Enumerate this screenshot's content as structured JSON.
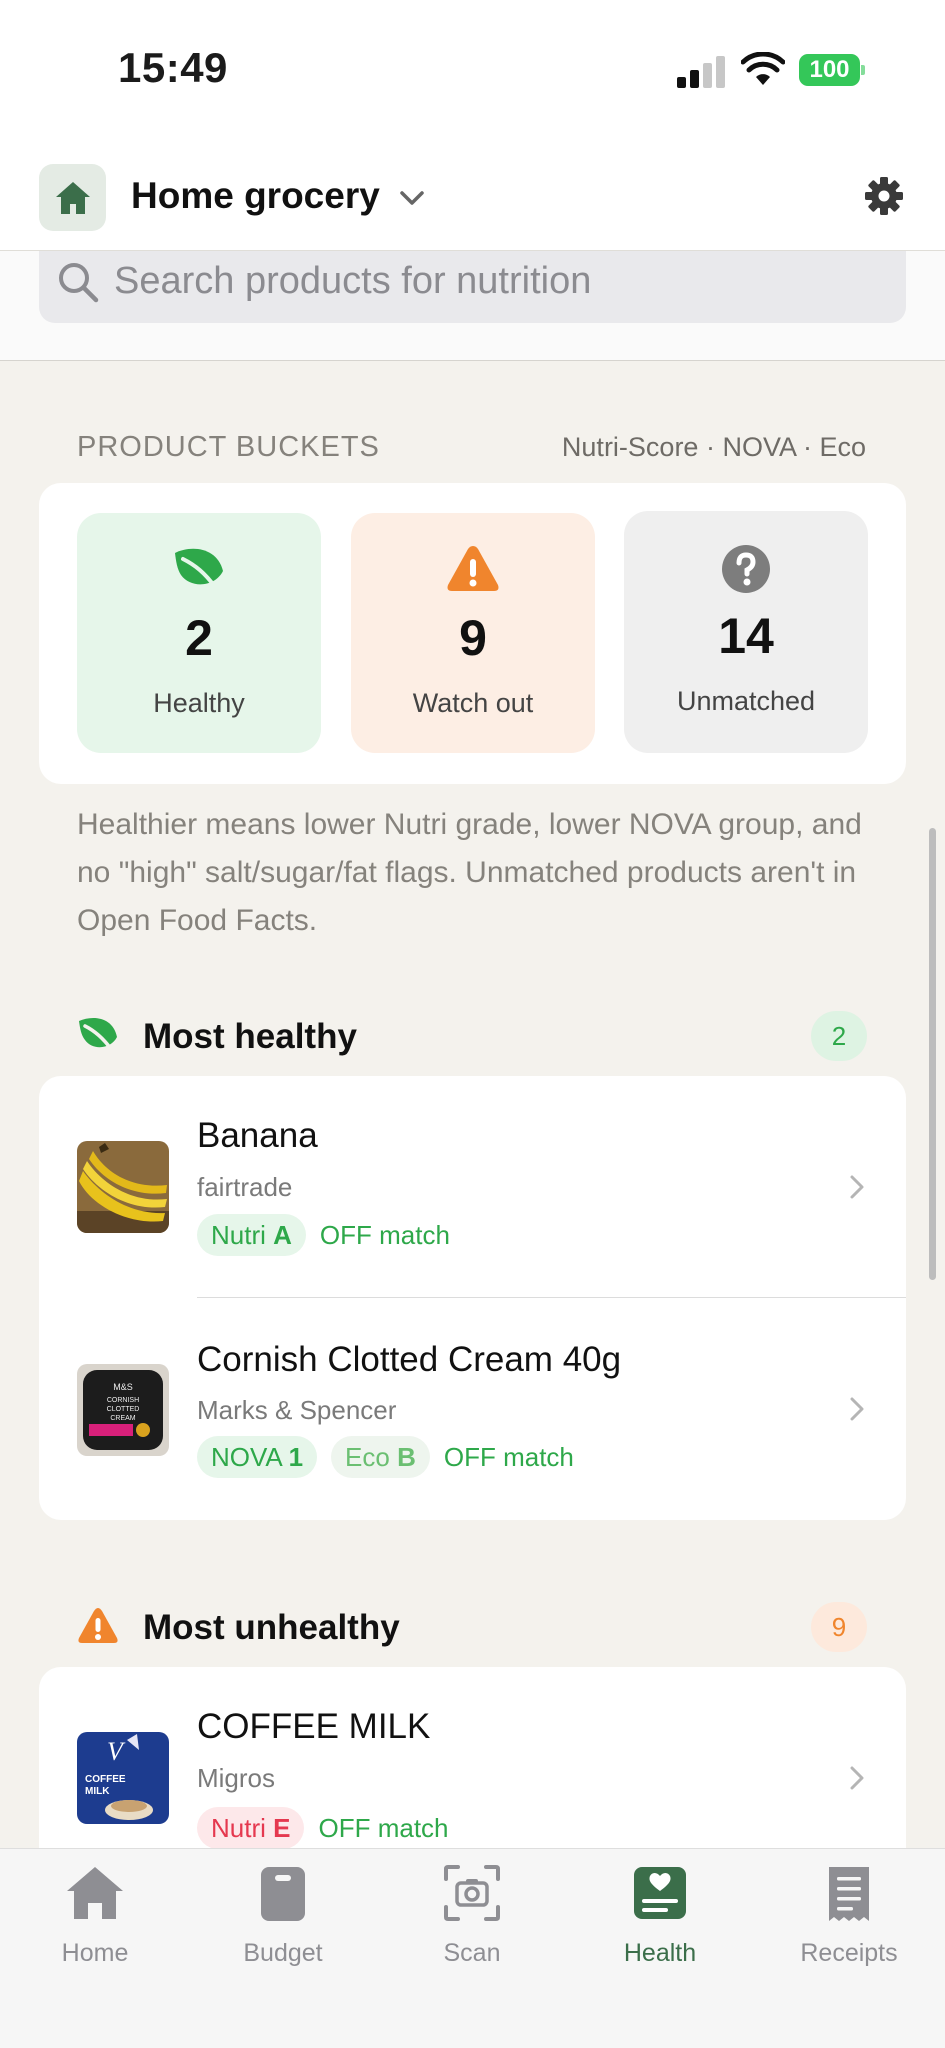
{
  "status_bar": {
    "time": "15:49",
    "battery": "100"
  },
  "header": {
    "title": "Home grocery"
  },
  "search": {
    "placeholder": "Search products for nutrition"
  },
  "buckets_section": {
    "label": "PRODUCT BUCKETS",
    "meta": "Nutri-Score · NOVA · Eco",
    "buckets": [
      {
        "count": "2",
        "label": "Healthy"
      },
      {
        "count": "9",
        "label": "Watch out"
      },
      {
        "count": "14",
        "label": "Unmatched"
      }
    ],
    "explainer": "Healthier means lower Nutri grade, lower NOVA group, and no \"high\" salt/sugar/fat flags. Unmatched products aren't in Open Food Facts."
  },
  "most_healthy": {
    "title": "Most healthy",
    "count": "2",
    "items": [
      {
        "name": "Banana",
        "brand": "fairtrade",
        "tags": [
          {
            "prefix": "Nutri",
            "grade": "A"
          }
        ],
        "match": "OFF match"
      },
      {
        "name": "Cornish Clotted Cream 40g",
        "brand": "Marks & Spencer",
        "tags": [
          {
            "prefix": "NOVA",
            "grade": "1"
          },
          {
            "prefix": "Eco",
            "grade": "B"
          }
        ],
        "match": "OFF match"
      }
    ]
  },
  "most_unhealthy": {
    "title": "Most unhealthy",
    "count": "9",
    "items": [
      {
        "name": "COFFEE MILK",
        "brand": "Migros",
        "tags": [
          {
            "prefix": "Nutri",
            "grade": "E"
          }
        ],
        "match": "OFF match"
      }
    ]
  },
  "tabs": [
    {
      "label": "Home",
      "icon": "house-icon"
    },
    {
      "label": "Budget",
      "icon": "clipboard-icon"
    },
    {
      "label": "Scan",
      "icon": "camera-icon"
    },
    {
      "label": "Health",
      "icon": "health-card-icon",
      "active": true
    },
    {
      "label": "Receipts",
      "icon": "receipt-icon"
    }
  ],
  "colors": {
    "accent": "#3b6e4a",
    "healthy": "#2ea84a",
    "warning": "#f0852d",
    "danger": "#e5384f"
  }
}
